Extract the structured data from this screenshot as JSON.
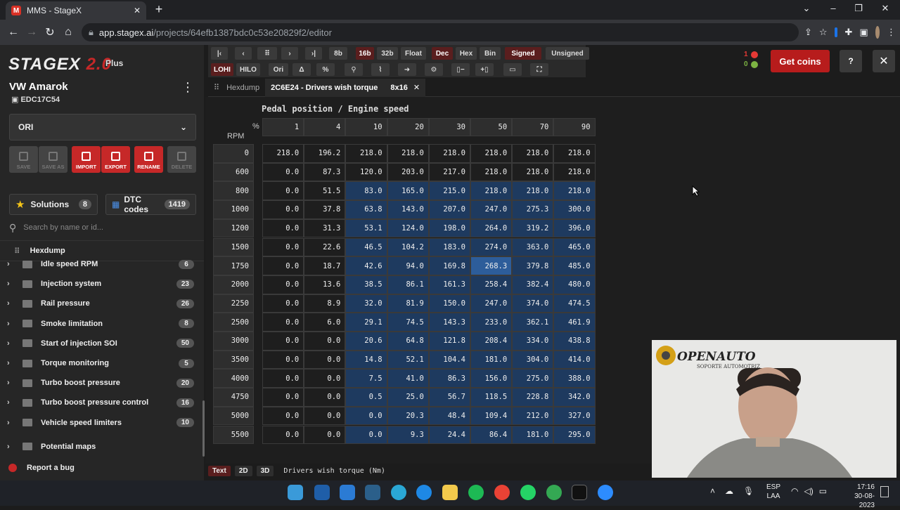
{
  "browser": {
    "tab_title": "MMS - StageX",
    "url_host": "app.stagex.ai",
    "url_path": "/projects/64efb1387bdc0c53e20829f2/editor"
  },
  "sidebar": {
    "logo_text": "STAGEX",
    "logo_version": "2.0",
    "plan": "Plus",
    "vehicle": "VW Amarok",
    "ecu": "EDC17C54",
    "file_select": "ORI",
    "actions": [
      {
        "label": "SAVE",
        "enabled": false
      },
      {
        "label": "SAVE AS",
        "enabled": false
      },
      {
        "label": "IMPORT",
        "enabled": true
      },
      {
        "label": "EXPORT",
        "enabled": true
      },
      {
        "label": "RENAME",
        "enabled": true
      },
      {
        "label": "DELETE",
        "enabled": false
      }
    ],
    "solutions_label": "Solutions",
    "solutions_count": "8",
    "dtc_label": "DTC codes",
    "dtc_count": "1419",
    "search_placeholder": "Search by name or id...",
    "hexdump_label": "Hexdump",
    "categories": [
      {
        "name": "Idle speed RPM",
        "count": "6"
      },
      {
        "name": "Injection system",
        "count": "23"
      },
      {
        "name": "Rail pressure",
        "count": "26"
      },
      {
        "name": "Smoke limitation",
        "count": "8"
      },
      {
        "name": "Start of injection SOI",
        "count": "50"
      },
      {
        "name": "Torque monitoring",
        "count": "5"
      },
      {
        "name": "Turbo boost pressure",
        "count": "20"
      },
      {
        "name": "Turbo boost pressure control",
        "count": "16"
      },
      {
        "name": "Vehicle speed limiters",
        "count": "10"
      },
      {
        "name": "Potential maps",
        "count": ""
      }
    ],
    "report_bug": "Report a bug"
  },
  "toolbar": {
    "row1": [
      "8b",
      "16b",
      "32b",
      "Float",
      "Dec",
      "Hex",
      "Bin",
      "Signed",
      "Unsigned"
    ],
    "row2": [
      "LOHI",
      "HILO",
      "Ori",
      "Δ",
      "%"
    ]
  },
  "header_right": {
    "counter_top": "1",
    "counter_bottom": "0",
    "get_coins": "Get coins",
    "help": "?",
    "close": "✕"
  },
  "doc_tabs": {
    "hexdump": "Hexdump",
    "map_tab": "2C6E24 - Drivers wish torque",
    "size": "8x16",
    "close": "✕"
  },
  "map": {
    "title": "Pedal position / Engine speed",
    "x_unit": "%",
    "y_unit": "RPM",
    "columns": [
      "1",
      "4",
      "10",
      "20",
      "30",
      "50",
      "70",
      "90"
    ],
    "rows": [
      "0",
      "600",
      "800",
      "1000",
      "1200",
      "1500",
      "1750",
      "2000",
      "2250",
      "2500",
      "3000",
      "3500",
      "4000",
      "4750",
      "5000",
      "5500"
    ],
    "values": [
      [
        "218.0",
        "196.2",
        "218.0",
        "218.0",
        "218.0",
        "218.0",
        "218.0",
        "218.0"
      ],
      [
        "0.0",
        "87.3",
        "120.0",
        "203.0",
        "217.0",
        "218.0",
        "218.0",
        "218.0"
      ],
      [
        "0.0",
        "51.5",
        "83.0",
        "165.0",
        "215.0",
        "218.0",
        "218.0",
        "218.0"
      ],
      [
        "0.0",
        "37.8",
        "63.8",
        "143.0",
        "207.0",
        "247.0",
        "275.3",
        "300.0"
      ],
      [
        "0.0",
        "31.3",
        "53.1",
        "124.0",
        "198.0",
        "264.0",
        "319.2",
        "396.0"
      ],
      [
        "0.0",
        "22.6",
        "46.5",
        "104.2",
        "183.0",
        "274.0",
        "363.0",
        "465.0"
      ],
      [
        "0.0",
        "18.7",
        "42.6",
        "94.0",
        "169.8",
        "268.3",
        "379.8",
        "485.0"
      ],
      [
        "0.0",
        "13.6",
        "38.5",
        "86.1",
        "161.3",
        "258.4",
        "382.4",
        "480.0"
      ],
      [
        "0.0",
        "8.9",
        "32.0",
        "81.9",
        "150.0",
        "247.0",
        "374.0",
        "474.5"
      ],
      [
        "0.0",
        "6.0",
        "29.1",
        "74.5",
        "143.3",
        "233.0",
        "362.1",
        "461.9"
      ],
      [
        "0.0",
        "0.0",
        "20.6",
        "64.8",
        "121.8",
        "208.4",
        "334.0",
        "438.8"
      ],
      [
        "0.0",
        "0.0",
        "14.8",
        "52.1",
        "104.4",
        "181.0",
        "304.0",
        "414.0"
      ],
      [
        "0.0",
        "0.0",
        "7.5",
        "41.0",
        "86.3",
        "156.0",
        "275.0",
        "388.0"
      ],
      [
        "0.0",
        "0.0",
        "0.5",
        "25.0",
        "56.7",
        "118.5",
        "228.8",
        "342.0"
      ],
      [
        "0.0",
        "0.0",
        "0.0",
        "20.3",
        "48.4",
        "109.4",
        "212.0",
        "327.0"
      ],
      [
        "0.0",
        "0.0",
        "0.0",
        "9.3",
        "24.4",
        "86.4",
        "181.0",
        "295.0"
      ]
    ],
    "selected_row": 6,
    "selected_col": 5
  },
  "bottom_bar": {
    "views": [
      "Text",
      "2D",
      "3D"
    ],
    "label": "Drivers wish torque (Nm)"
  },
  "webcam": {
    "logo_text": "OPENAUTO",
    "logo_sub": "SOPORTE AUTOMOTRIZ"
  },
  "taskbar": {
    "lang_top": "ESP",
    "lang_bottom": "LAA",
    "time": "17:16",
    "date": "30-08-2023"
  },
  "colors": {
    "accent_red": "#c62828",
    "cell_blue": "#1e3a5f",
    "cell_selected": "#2d5d9a"
  }
}
